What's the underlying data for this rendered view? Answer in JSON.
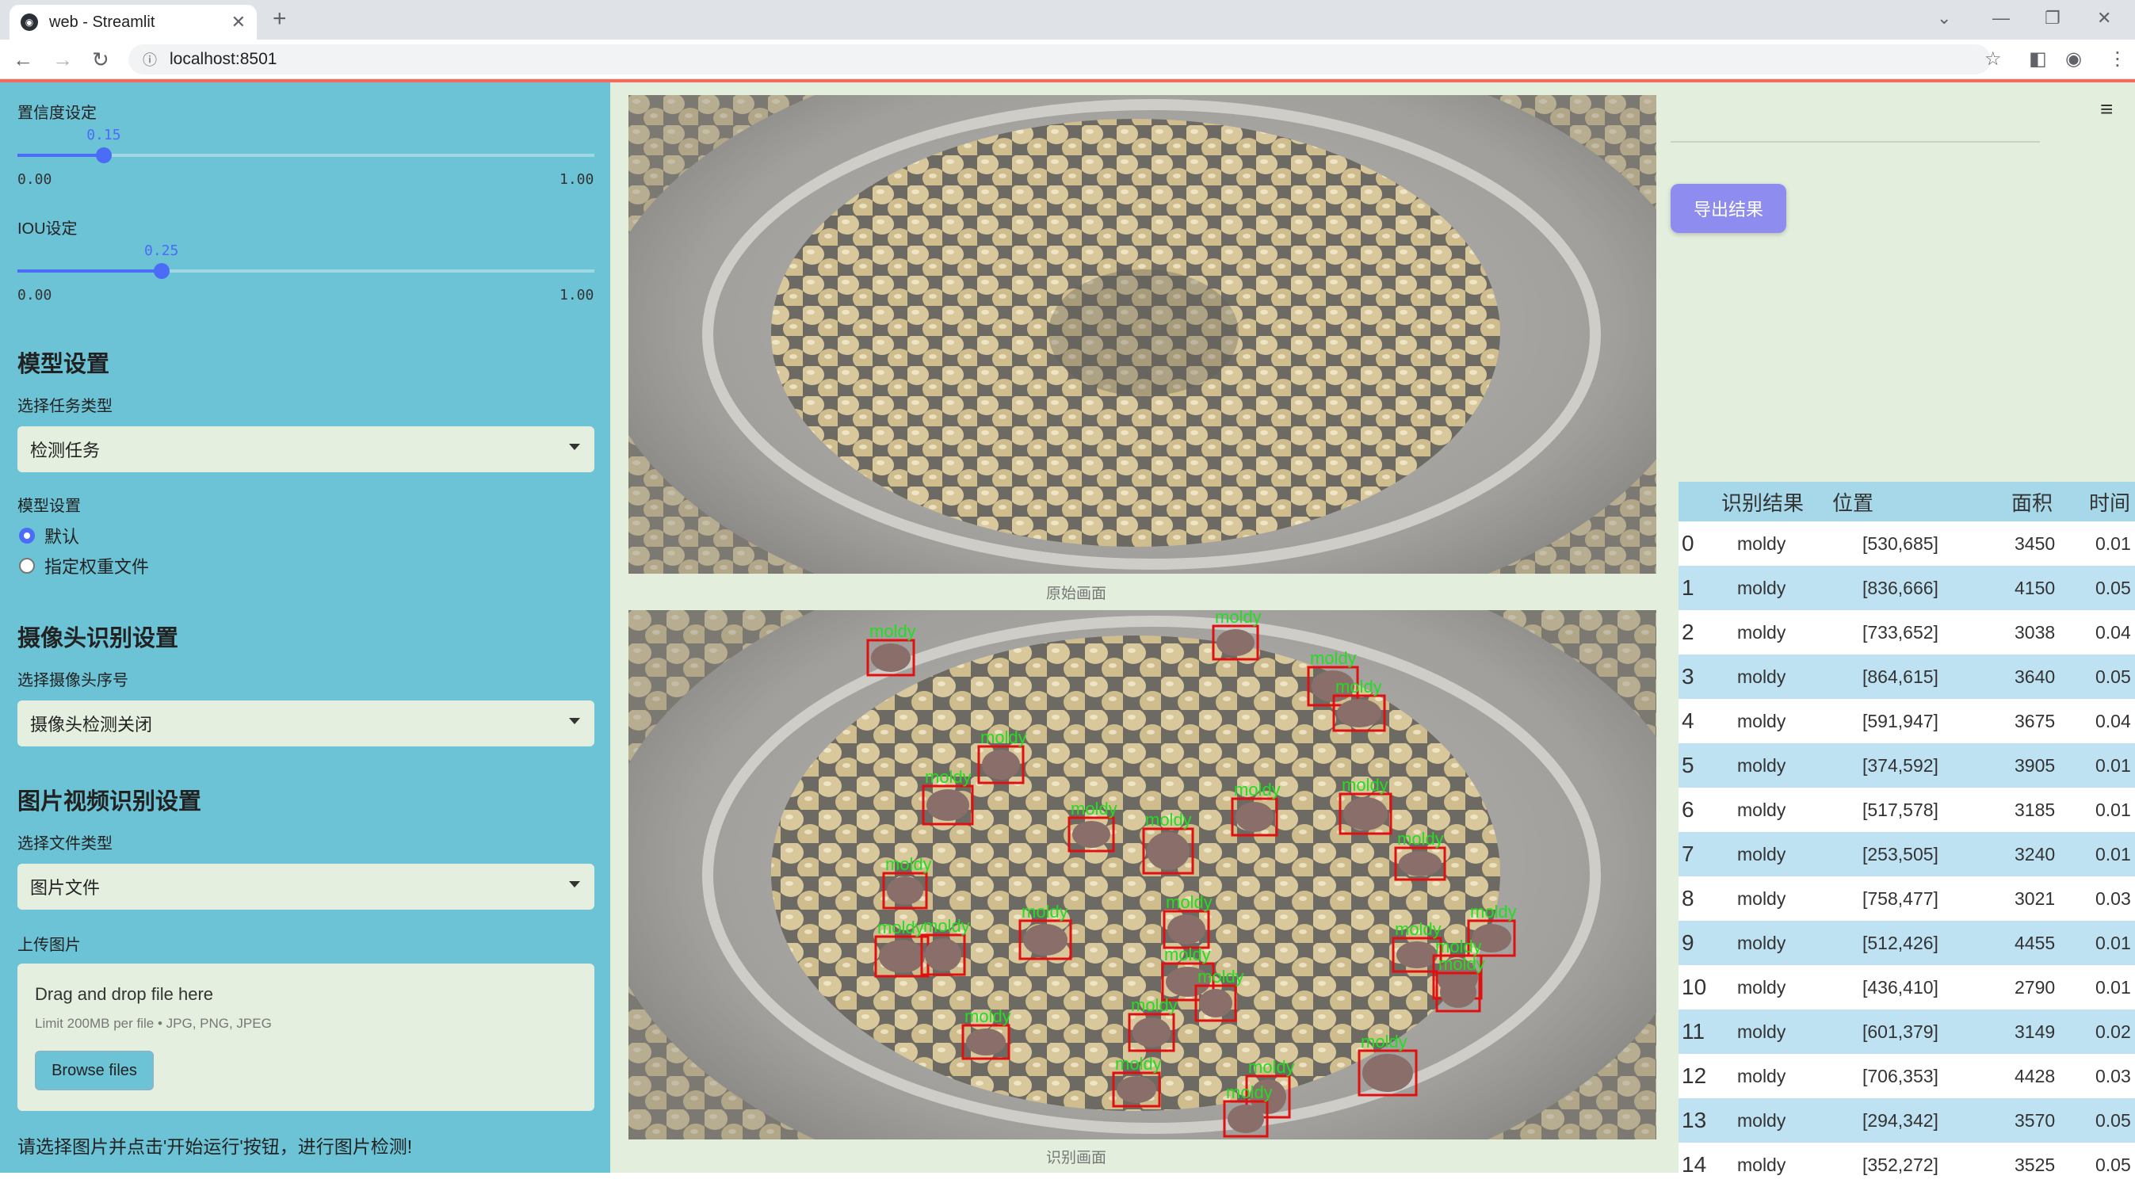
{
  "browser": {
    "tab_title": "web - Streamlit",
    "url": "localhost:8501"
  },
  "sidebar": {
    "conf_label": "置信度设定",
    "conf_value": "0.15",
    "conf_fraction": 0.15,
    "conf_min": "0.00",
    "conf_max": "1.00",
    "iou_label": "IOU设定",
    "iou_value": "0.25",
    "iou_fraction": 0.25,
    "iou_min": "0.00",
    "iou_max": "1.00",
    "model_section": "模型设置",
    "task_label": "选择任务类型",
    "task_value": "检测任务",
    "model_label": "模型设置",
    "radio_default": "默认",
    "radio_custom": "指定权重文件",
    "camera_section": "摄像头识别设置",
    "camera_label": "选择摄像头序号",
    "camera_value": "摄像头检测关闭",
    "media_section": "图片视频识别设置",
    "filetype_label": "选择文件类型",
    "filetype_value": "图片文件",
    "upload_label": "上传图片",
    "upload_title": "Drag and drop file here",
    "upload_limit": "Limit 200MB per file • JPG, PNG, JPEG",
    "browse_label": "Browse files",
    "hint": "请选择图片并点击'开始运行'按钮，进行图片检测!"
  },
  "main": {
    "original_caption": "原始画面",
    "result_caption": "识别画面",
    "export_label": "导出结果",
    "detection_label": "moldy"
  },
  "table": {
    "headers": [
      "识别结果",
      "位置",
      "面积",
      "时间"
    ],
    "rows": [
      {
        "idx": "0",
        "result": "moldy",
        "pos": "[530,685]",
        "area": "3450",
        "time": "0.01"
      },
      {
        "idx": "1",
        "result": "moldy",
        "pos": "[836,666]",
        "area": "4150",
        "time": "0.05"
      },
      {
        "idx": "2",
        "result": "moldy",
        "pos": "[733,652]",
        "area": "3038",
        "time": "0.04"
      },
      {
        "idx": "3",
        "result": "moldy",
        "pos": "[864,615]",
        "area": "3640",
        "time": "0.05"
      },
      {
        "idx": "4",
        "result": "moldy",
        "pos": "[591,947]",
        "area": "3675",
        "time": "0.04"
      },
      {
        "idx": "5",
        "result": "moldy",
        "pos": "[374,592]",
        "area": "3905",
        "time": "0.01"
      },
      {
        "idx": "6",
        "result": "moldy",
        "pos": "[517,578]",
        "area": "3185",
        "time": "0.01"
      },
      {
        "idx": "7",
        "result": "moldy",
        "pos": "[253,505]",
        "area": "3240",
        "time": "0.01"
      },
      {
        "idx": "8",
        "result": "moldy",
        "pos": "[758,477]",
        "area": "3021",
        "time": "0.03"
      },
      {
        "idx": "9",
        "result": "moldy",
        "pos": "[512,426]",
        "area": "4455",
        "time": "0.01"
      },
      {
        "idx": "10",
        "result": "moldy",
        "pos": "[436,410]",
        "area": "2790",
        "time": "0.01"
      },
      {
        "idx": "11",
        "result": "moldy",
        "pos": "[601,379]",
        "area": "3149",
        "time": "0.02"
      },
      {
        "idx": "12",
        "result": "moldy",
        "pos": "[706,353]",
        "area": "4428",
        "time": "0.03"
      },
      {
        "idx": "13",
        "result": "moldy",
        "pos": "[294,342]",
        "area": "3570",
        "time": "0.05"
      },
      {
        "idx": "14",
        "result": "moldy",
        "pos": "[352,272]",
        "area": "3525",
        "time": "0.05"
      }
    ]
  },
  "colors": {
    "sidebar_bg": "#6cc3d5",
    "main_bg": "#e3eedd",
    "accent": "#4a6cf7",
    "export_btn": "#8f8cf0",
    "box_red": "#e01010",
    "label_green": "#22dd22"
  }
}
